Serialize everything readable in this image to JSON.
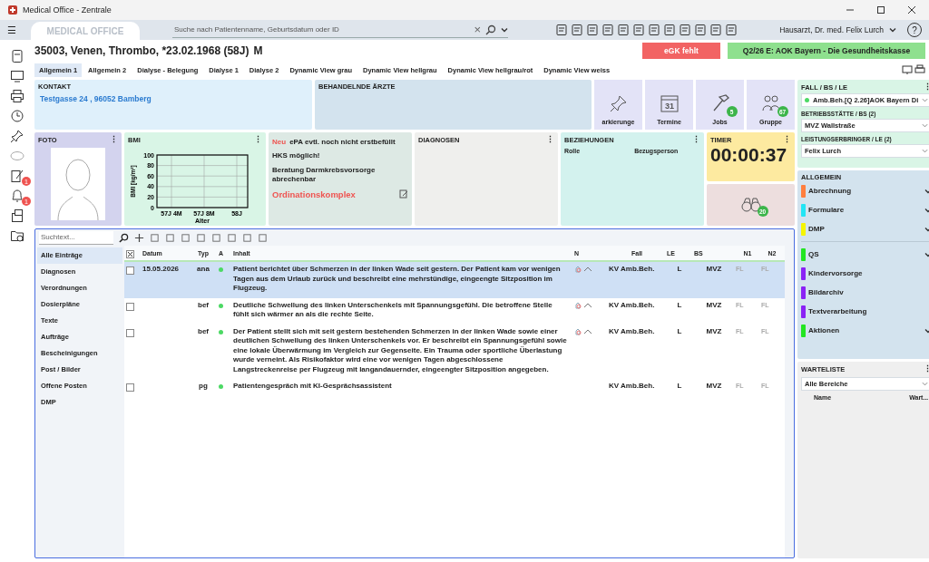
{
  "window": {
    "title": "Medical Office - Zentrale"
  },
  "topbar": {
    "menu": "☰",
    "logo": "MEDICAL OFFICE",
    "search_placeholder": "Suche nach Patientenname, Geburtsdatum oder ID",
    "clear": "×",
    "user": "Hausarzt, Dr. med. Felix Lurch",
    "help": "?"
  },
  "left_toolbar": [
    {
      "kind": "tablet"
    },
    {
      "kind": "screen"
    },
    {
      "kind": "printer"
    },
    {
      "kind": "clock"
    },
    {
      "kind": "pin"
    },
    {
      "kind": "disc"
    },
    {
      "kind": "form",
      "badge": "1"
    },
    {
      "kind": "bell",
      "badge": "1"
    },
    {
      "kind": "stack"
    },
    {
      "kind": "folder"
    }
  ],
  "patient": {
    "number": "35003,",
    "name": "Venen, Thrombo",
    "birth": ", *23.02.1968 (58J)",
    "sex": "M",
    "egk": "eGK fehlt",
    "insurance": "Q2/26 E: AOK Bayern - Die Gesundheitskasse"
  },
  "tabs": [
    {
      "label": "Allgemein 1",
      "selected": true
    },
    {
      "label": "Allgemein 2",
      "selected": false
    },
    {
      "label": "Dialyse - Belegung",
      "selected": false
    },
    {
      "label": "Dialyse 1",
      "selected": false
    },
    {
      "label": "Dialyse 2",
      "selected": false
    },
    {
      "label": "Dynamic View grau",
      "selected": false
    },
    {
      "label": "Dynamic View hellgrau",
      "selected": false
    },
    {
      "label": "Dynamic View hellgrau/rot",
      "selected": false
    },
    {
      "label": "Dynamic View weiss",
      "selected": false
    }
  ],
  "kontakt": {
    "title": "KONTAKT",
    "address": "Testgasse 24 , 96052 Bamberg"
  },
  "aerzte": {
    "title": "BEHANDELNDE ÄRZTE"
  },
  "tiles": [
    {
      "kind": "pin",
      "label": "arkierunge"
    },
    {
      "kind": "calendar",
      "label": "Termine",
      "day": "31"
    },
    {
      "kind": "hammer",
      "label": "Jobs",
      "badge": "5"
    },
    {
      "kind": "group",
      "label": "Gruppe",
      "badge": "67"
    }
  ],
  "foto": {
    "title": "FOTO",
    "menu": "⋮"
  },
  "bmi": {
    "title": "BMI",
    "menu": "⋮",
    "chart_data": {
      "type": "line",
      "xlabel": "Alter",
      "ylabel": "BMI [kg/m²]",
      "yticks": [
        0,
        20,
        40,
        60,
        80,
        100
      ],
      "categories": [
        "57J 4M",
        "57J 8M",
        "58J"
      ],
      "ylim": [
        0,
        100
      ],
      "grid": true
    }
  },
  "hinweise": {
    "new_label": "Neu",
    "items": [
      "ePA evtl. noch nicht erstbefüllt",
      "HKS möglich!",
      "Beratung Darmkrebsvorsorge abrechenbar"
    ],
    "highlight": "Ordinationskomplex"
  },
  "diagnosen": {
    "title": "DIAGNOSEN",
    "menu": "⋮"
  },
  "beziehungen": {
    "title": "BEZIEHUNGEN",
    "menu": "⋮",
    "columns": [
      "Rolle",
      "Bezugsperson"
    ]
  },
  "timer": {
    "title": "TIMER",
    "menu": "⋮",
    "time": "00:00:37"
  },
  "binoculars": {
    "badge": "20"
  },
  "journal": {
    "search_placeholder": "Suchtext...",
    "filters": [
      {
        "label": "Alle Einträge",
        "selected": true
      },
      {
        "label": "Diagnosen",
        "selected": false
      },
      {
        "label": "Verordnungen",
        "selected": false
      },
      {
        "label": "Dosierpläne",
        "selected": false
      },
      {
        "label": "Texte",
        "selected": false
      },
      {
        "label": "Aufträge",
        "selected": false
      },
      {
        "label": "Bescheinigungen",
        "selected": false
      },
      {
        "label": "Post / Bilder",
        "selected": false
      },
      {
        "label": "Offene Posten",
        "selected": false
      },
      {
        "label": "DMP",
        "selected": false
      }
    ],
    "header_checked": true,
    "columns": [
      "Datum",
      "Typ",
      "A",
      "Inhalt",
      "N",
      "Fall",
      "LE",
      "BS",
      "N1",
      "N2"
    ],
    "rows": [
      {
        "selected": true,
        "checked": false,
        "date": "15.05.2026",
        "type": "ana",
        "content": "Patient berichtet über Schmerzen in der linken Wade seit gestern. Der Patient kam vor wenigen Tagen aus dem Urlaub zurück und beschreibt eine mehrstündige, eingeengte Sitzposition im Flugzeug.",
        "n_icons": true,
        "fall": "KV Amb.Beh.",
        "le": "L",
        "bs": "MVZ",
        "n1": "FL",
        "n2": "FL"
      },
      {
        "selected": false,
        "checked": false,
        "date": "",
        "type": "bef",
        "content": "Deutliche Schwellung des linken Unterschenkels mit Spannungsgefühl. Die betroffene Stelle fühlt sich wärmer an als die rechte Seite.",
        "n_icons": true,
        "fall": "KV Amb.Beh.",
        "le": "L",
        "bs": "MVZ",
        "n1": "FL",
        "n2": "FL"
      },
      {
        "selected": false,
        "checked": false,
        "date": "",
        "type": "bef",
        "content": "Der Patient stellt sich mit seit gestern bestehenden Schmerzen in der linken Wade sowie einer deutlichen Schwellung des linken Unterschenkels vor. Er beschreibt ein Spannungsgefühl sowie eine lokale Überwärmung im Vergleich zur Gegenseite. Ein Trauma oder sportliche Überlastung wurde verneint. Als Risikofaktor wird eine vor wenigen Tagen abgeschlossene Langstreckenreise per Flugzeug mit langandauernder, eingeengter Sitzposition angegeben.",
        "n_icons": true,
        "fall": "KV Amb.Beh.",
        "le": "L",
        "bs": "MVZ",
        "n1": "FL",
        "n2": "FL"
      },
      {
        "selected": false,
        "checked": false,
        "date": "",
        "type": "pg",
        "content": "Patientengespräch mit KI-Gesprächsassistent",
        "n_icons": false,
        "fall": "KV Amb.Beh.",
        "le": "L",
        "bs": "MVZ",
        "n1": "FL",
        "n2": "FL"
      }
    ]
  },
  "fall": {
    "title": "FALL / BS / LE",
    "menu": "⋮",
    "case": "Amb.Beh.[Q 2.26]AOK Bayern Di",
    "bs_label": "BETRIEBSSTÄTTE / BS (2)",
    "bs": "MVZ Wallstraße",
    "le_label": "LEISTUNGSERBRINGER / LE (2)",
    "le": "Felix Lurch"
  },
  "allgemein": {
    "title": "ALLGEMEIN",
    "groups": [
      {
        "items": [
          {
            "label": "Abrechnung",
            "color": "#ff7f3f",
            "expandable": true
          },
          {
            "label": "Formulare",
            "color": "#22e5f5",
            "expandable": true
          },
          {
            "label": "DMP",
            "color": "#f5f500",
            "expandable": true
          }
        ]
      },
      {
        "items": [
          {
            "label": "QS",
            "color": "#22e522",
            "expandable": true
          },
          {
            "label": "Kindervorsorge",
            "color": "#8a22f5",
            "expandable": false
          },
          {
            "label": "Bildarchiv",
            "color": "#8a22f5",
            "expandable": false
          },
          {
            "label": "Textverarbeitung",
            "color": "#8a22f5",
            "expandable": false
          },
          {
            "label": "Aktionen",
            "color": "#22e522",
            "expandable": true
          }
        ]
      }
    ]
  },
  "warteliste": {
    "title": "WARTELISTE",
    "menu": "⋮",
    "filter": "Alle Bereiche",
    "columns": [
      "Name",
      "Wart..."
    ]
  }
}
